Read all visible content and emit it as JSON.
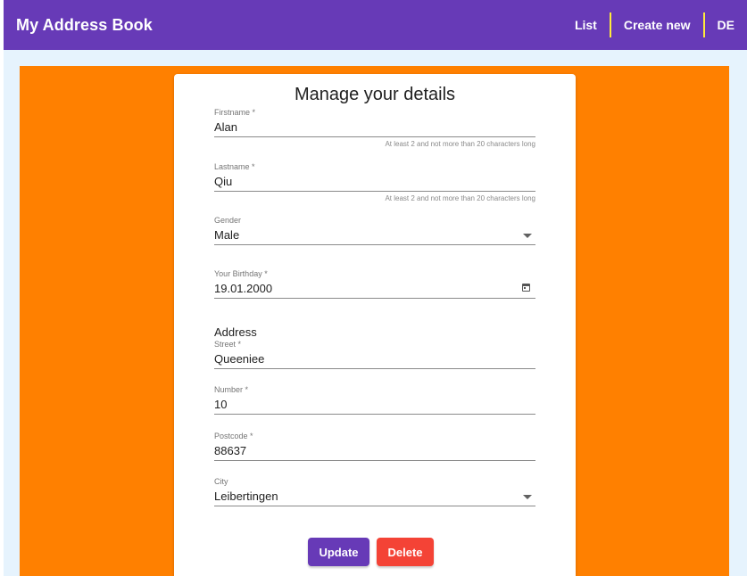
{
  "app": {
    "title": "My Address Book"
  },
  "nav": {
    "list": "List",
    "create_new": "Create new",
    "language": "DE"
  },
  "form": {
    "title": "Manage your details",
    "firstname": {
      "label": "Firstname *",
      "value": "Alan",
      "hint": "At least 2 and not more than 20 characters long"
    },
    "lastname": {
      "label": "Lastname *",
      "value": "Qiu",
      "hint": "At least 2 and not more than 20 characters long"
    },
    "gender": {
      "label": "Gender",
      "value": "Male"
    },
    "birthday": {
      "label": "Your Birthday *",
      "value": "19.01.2000"
    },
    "address_heading": "Address",
    "street": {
      "label": "Street *",
      "value": "Queeniee"
    },
    "number": {
      "label": "Number *",
      "value": "10"
    },
    "postcode": {
      "label": "Postcode *",
      "value": "88637"
    },
    "city": {
      "label": "City",
      "value": "Leibertingen"
    },
    "update_label": "Update",
    "delete_label": "Delete"
  },
  "colors": {
    "toolbar": "#673ab7",
    "nav_separator": "#ffeb3b",
    "page_background": "#e6f3fd",
    "orange_panel": "#ff8000",
    "update_button": "#673ab7",
    "delete_button": "#f44336"
  }
}
